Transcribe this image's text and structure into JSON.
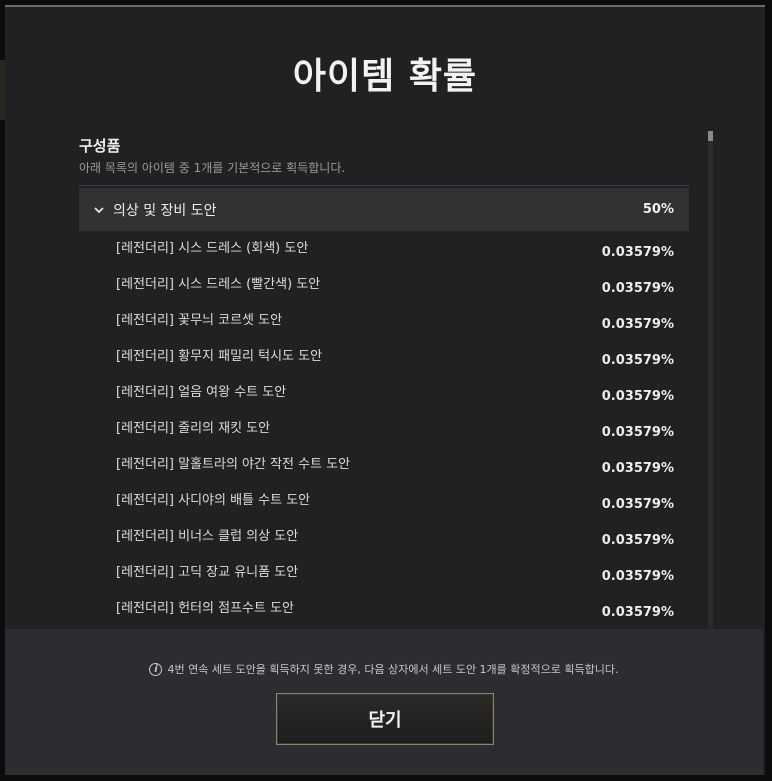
{
  "modal": {
    "title": "아이템 확률",
    "section_title": "구성품",
    "section_desc": "아래 목록의 아이템 중 1개를 기본적으로 획득합니다.",
    "group": {
      "name": "의상 및 장비 도안",
      "rate": "50%",
      "icon": "chevron-down-icon",
      "expanded": true
    },
    "items": [
      {
        "name": "[레전더리] 시스 드레스 (회색) 도안",
        "rate": "0.03579%"
      },
      {
        "name": "[레전더리] 시스 드레스 (빨간색) 도안",
        "rate": "0.03579%"
      },
      {
        "name": "[레전더리] 꽃무늬 코르셋 도안",
        "rate": "0.03579%"
      },
      {
        "name": "[레전더리] 황무지 패밀리 턱시도 도안",
        "rate": "0.03579%"
      },
      {
        "name": "[레전더리] 얼음 여왕 수트 도안",
        "rate": "0.03579%"
      },
      {
        "name": "[레전더리] 줄리의 재킷 도안",
        "rate": "0.03579%"
      },
      {
        "name": "[레전더리] 말홀트라의 야간 작전 수트 도안",
        "rate": "0.03579%"
      },
      {
        "name": "[레전더리] 사디야의 배틀 수트 도안",
        "rate": "0.03579%"
      },
      {
        "name": "[레전더리] 비너스 클럽 의상 도안",
        "rate": "0.03579%"
      },
      {
        "name": "[레전더리] 고딕 장교 유니폼 도안",
        "rate": "0.03579%"
      },
      {
        "name": "[레전더리] 헌터의 점프수트 도안",
        "rate": "0.03579%"
      }
    ],
    "notice": "4번 연속 세트 도안을 획득하지 못한 경우, 다음 상자에서 세트 도안 1개를 확정적으로 획득합니다.",
    "notice_icon": "info-icon",
    "close_label": "닫기"
  }
}
